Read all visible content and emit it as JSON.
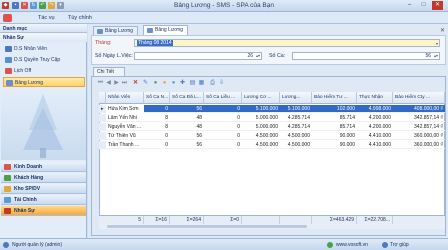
{
  "window": {
    "title": "Bảng Lương - SMS - SPA của Bạn"
  },
  "menu": [
    "Tác vụ",
    "Tùy chỉnh"
  ],
  "left_panel": {
    "header": "Danh mục",
    "group": "Nhân Sự",
    "items": [
      "D.S Nhân Viên",
      "D.S Quyền Truy Cập",
      "Lịch Off",
      "Bảng Lương"
    ],
    "categories": [
      "Kinh Doanh",
      "Khách Hàng",
      "Kho SP/DV",
      "Tài Chính",
      "Nhân Sự"
    ]
  },
  "tabs": [
    "Bảng Lương",
    "Bảng Lương"
  ],
  "form": {
    "month_label": "Tháng:",
    "month_value": "Tháng 08 2014",
    "workdays_label": "Số Ngày L.Việc:",
    "workdays_value": "26",
    "shifts_label": "Số Ca:",
    "shifts_value": "56"
  },
  "detail_label": "Chi Tiết",
  "grid": {
    "headers": [
      "Nhân Viên",
      "Số Ca N...",
      "Số Ca Đã L...",
      "Số Ca Liều ...",
      "Lương Cơ ...",
      "Lương...",
      "Bảo Hiểm Tư ...",
      "Thực Nhận",
      "Bảo Hiểm Cty ..."
    ],
    "rows": [
      [
        "Hứa Kim Sơn",
        "0",
        "56",
        "0",
        "5.100.000",
        "5.100.000",
        "102.000",
        "4.998.000",
        "408.000,00 ₫"
      ],
      [
        "Lâm Yến Nhi",
        "8",
        "48",
        "0",
        "5.000.000",
        "4.285.714",
        "85.714",
        "4.200.000",
        "342.857,14 ₫"
      ],
      [
        "Nguyễn Văn ...",
        "8",
        "48",
        "0",
        "5.000.000",
        "4.285.714",
        "85.714",
        "4.200.000",
        "342.857,14 ₫"
      ],
      [
        "Từ Thiên Vũ",
        "0",
        "56",
        "0",
        "4.500.000",
        "4.500.000",
        "90.000",
        "4.410.000",
        "360.000,00 ₫"
      ],
      [
        "Trần Thanh ...",
        "0",
        "56",
        "0",
        "4.500.000",
        "4.500.000",
        "90.000",
        "4.410.000",
        "360.000,00 ₫"
      ]
    ],
    "footer": [
      "5",
      "Σ=16",
      "Σ=264",
      "Σ=0",
      "",
      "",
      "Σ=463.429",
      "Σ=22.708..."
    ]
  },
  "status": {
    "user": "Người quản lý (admin)",
    "website": "www.vosoft.vn",
    "help": "Trợ giúp"
  },
  "colors": {
    "accent": "#316ac5",
    "selected_nav": "#ffd36b",
    "active_category": "#f5a93c"
  }
}
